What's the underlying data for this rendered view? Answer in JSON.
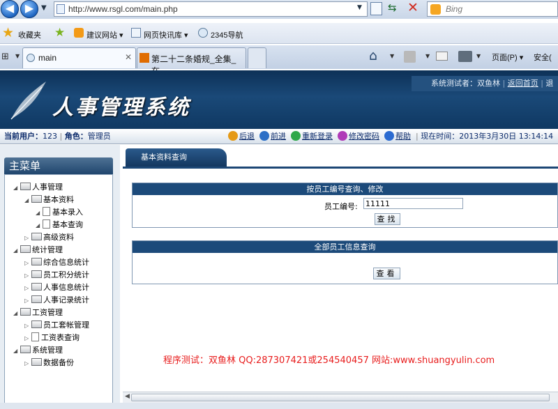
{
  "browser": {
    "url": "http://www.rsgl.com/main.php",
    "search_placeholder": "Bing",
    "favorites_label": "收藏夹",
    "fav_links": [
      "建议网站 ▾",
      "网页快讯库 ▾",
      "2345导航"
    ],
    "tabs": [
      {
        "label": "main"
      },
      {
        "label": "第二十二条婚规_全集_在..."
      }
    ],
    "menu_page": "页面(P) ▾",
    "menu_safety": "安全("
  },
  "header": {
    "title": "人事管理系统",
    "tester_label": "系统测试者：双鱼林",
    "home_link": "返回首页",
    "extra_link": "退"
  },
  "infobar": {
    "current_user_label": "当前用户：",
    "current_user": "123",
    "role_label": "角色：",
    "role": "管理员",
    "back": "后退",
    "forward": "前进",
    "relogin": "重新登录",
    "change_password": "修改密码",
    "help": "帮助",
    "time_label": "现在时间：",
    "time_value": "2013年3月30日  13:14:14"
  },
  "sidebar": {
    "title": "主菜单",
    "tree": [
      {
        "label": "人事管理",
        "kind": "folder",
        "level": 0,
        "expanded": true
      },
      {
        "label": "基本资料",
        "kind": "folder",
        "level": 1,
        "expanded": true
      },
      {
        "label": "基本录入",
        "kind": "doc",
        "level": 2
      },
      {
        "label": "基本查询",
        "kind": "doc",
        "level": 2
      },
      {
        "label": "高级资料",
        "kind": "folder",
        "level": 1,
        "expanded": false
      },
      {
        "label": "统计管理",
        "kind": "folder",
        "level": 0,
        "expanded": true
      },
      {
        "label": "综合信息统计",
        "kind": "folder",
        "level": 1,
        "expanded": false
      },
      {
        "label": "员工积分统计",
        "kind": "folder",
        "level": 1,
        "expanded": false
      },
      {
        "label": "人事信息统计",
        "kind": "folder",
        "level": 1,
        "expanded": false
      },
      {
        "label": "人事记录统计",
        "kind": "folder",
        "level": 1,
        "expanded": false
      },
      {
        "label": "工资管理",
        "kind": "folder",
        "level": 0,
        "expanded": true
      },
      {
        "label": "员工套帐管理",
        "kind": "folder",
        "level": 1,
        "expanded": false
      },
      {
        "label": "工资表查询",
        "kind": "doc",
        "level": 1
      },
      {
        "label": "系统管理",
        "kind": "folder",
        "level": 0,
        "expanded": true
      },
      {
        "label": "数据备份",
        "kind": "folder",
        "level": 1,
        "expanded": false
      }
    ]
  },
  "main": {
    "tab_label": "基本资料查询",
    "panel1": {
      "title": "按员工编号查询、修改",
      "field_label": "员工编号:",
      "field_value": "11111",
      "button": "查找"
    },
    "panel2": {
      "title": "全部员工信息查询",
      "button": "查看"
    },
    "footer_note": "程序测试：双鱼林 QQ:287307421或254540457 网站:www.shuangyulin.com"
  }
}
